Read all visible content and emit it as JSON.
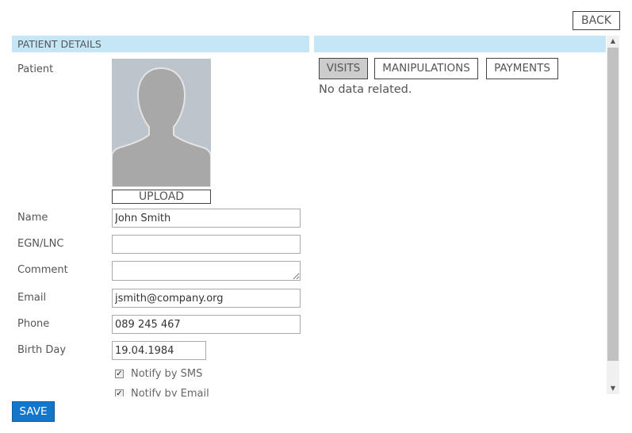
{
  "header": {
    "back_label": "BACK"
  },
  "left": {
    "title": "PATIENT DETAILS",
    "patient_label": "Patient",
    "upload_label": "UPLOAD",
    "fields": {
      "name": {
        "label": "Name",
        "value": "John Smith"
      },
      "egn": {
        "label": "EGN/LNC",
        "value": ""
      },
      "comment": {
        "label": "Comment",
        "value": ""
      },
      "email": {
        "label": "Email",
        "value": "jsmith@company.org"
      },
      "phone": {
        "label": "Phone",
        "value": "089 245 467"
      },
      "birthday": {
        "label": "Birth Day",
        "value": "19.04.1984"
      }
    },
    "checkboxes": [
      {
        "label": "Notify by SMS",
        "checked": true
      },
      {
        "label": "Notify by Email",
        "checked": true
      }
    ]
  },
  "right": {
    "title": "",
    "tabs": [
      {
        "label": "VISITS",
        "active": true
      },
      {
        "label": "MANIPULATIONS",
        "active": false
      },
      {
        "label": "PAYMENTS",
        "active": false
      }
    ],
    "empty_message": "No data related."
  },
  "footer": {
    "save_label": "SAVE"
  },
  "colors": {
    "header_bg": "#c5e6f6",
    "save_bg": "#1376c8",
    "active_tab_bg": "#cccccc"
  }
}
